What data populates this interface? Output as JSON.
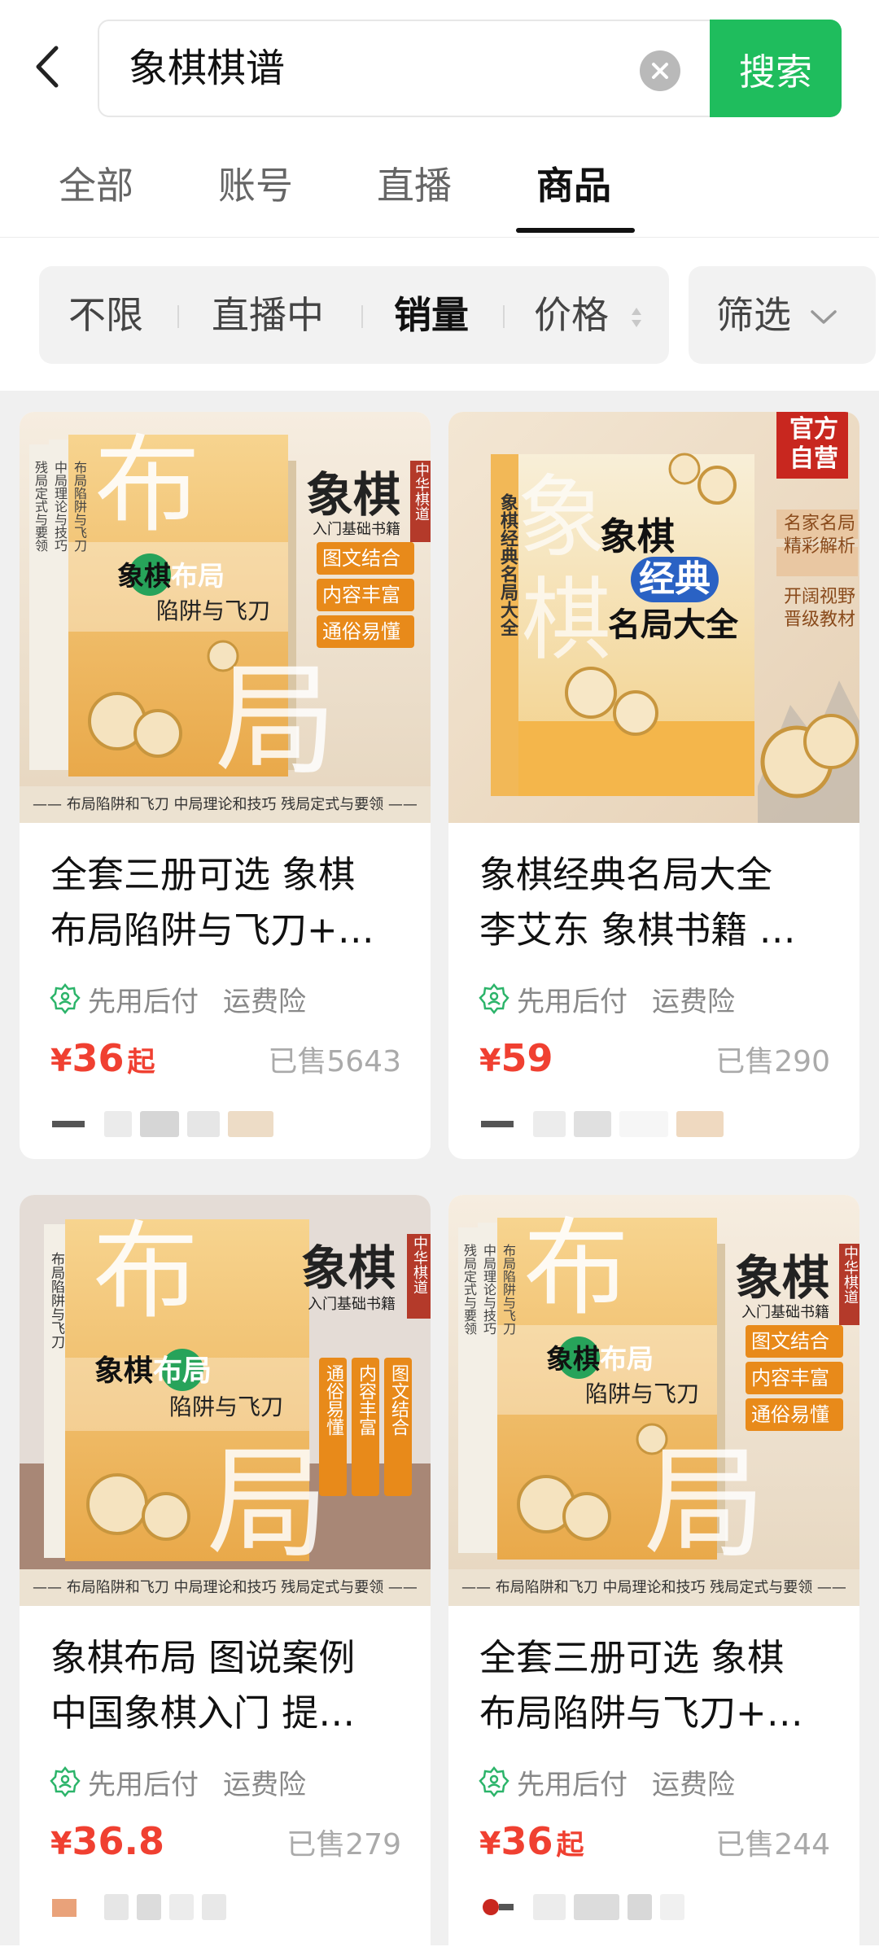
{
  "search": {
    "query": "象棋棋谱",
    "button": "搜索"
  },
  "tabs": [
    {
      "label": "全部"
    },
    {
      "label": "账号"
    },
    {
      "label": "直播"
    },
    {
      "label": "商品"
    }
  ],
  "active_tab": "商品",
  "filters": {
    "items": [
      {
        "label": "不限"
      },
      {
        "label": "直播中"
      },
      {
        "label": "销量"
      },
      {
        "label": "价格"
      }
    ],
    "active": "销量",
    "screen": "筛选"
  },
  "colors": {
    "brand": "#1fbd5d",
    "price": "#f04031"
  },
  "products": [
    {
      "title_line1": "全套三册可选 象棋",
      "title_line2": "布局陷阱与飞刀+…",
      "badge1": "先用后付",
      "badge2": "运费险",
      "price_symbol": "¥",
      "price": "36",
      "price_suffix": "起",
      "sold": "已售5643",
      "cover": {
        "book_title": "象棋布局陷阱与飞刀",
        "book_title_a": "象棋",
        "book_title_b": "布局",
        "book_title_c": "陷阱与飞刀",
        "series": "象棋",
        "series_sub": "入门基础书籍",
        "side_tag": "中华棋道",
        "big_char1": "布",
        "big_char2": "局",
        "spine1": "布局陷阱与飞刀",
        "spine2": "中局理论与技巧",
        "spine3": "残局定式与要领",
        "tags": [
          "图文结合",
          "内容丰富",
          "通俗易懂"
        ],
        "strip": "—— 布局陷阱和飞刀 中局理论和技巧 残局定式与要领 ——"
      }
    },
    {
      "title_line1": "象棋经典名局大全",
      "title_line2": "李艾东 象棋书籍 …",
      "badge1": "先用后付",
      "badge2": "运费险",
      "price_symbol": "¥",
      "price": "59",
      "price_suffix": "",
      "sold": "已售290",
      "cover": {
        "corner": "官方自营",
        "corner_a": "官方",
        "corner_b": "自营",
        "book_title_a": "象棋",
        "book_title_b": "经典",
        "book_title_c": "名局大全",
        "spine": "象棋经典名局大全",
        "tags": [
          "名家名局",
          "精彩解析",
          "开阔视野",
          "晋级教材"
        ],
        "tag_line1": "名家名局",
        "tag_line2": "精彩解析",
        "tag_line3": "开阔视野",
        "tag_line4": "晋级教材",
        "bg_char1": "象",
        "bg_char2": "棋"
      }
    },
    {
      "title_line1": "象棋布局 图说案例",
      "title_line2": "中国象棋入门 提…",
      "badge1": "先用后付",
      "badge2": "运费险",
      "price_symbol": "¥",
      "price": "36.8",
      "price_suffix": "",
      "sold": "已售279",
      "cover": {
        "book_title_a": "象棋",
        "book_title_b": "布局",
        "book_title_c": "陷阱与飞刀",
        "series": "象棋",
        "series_sub": "入门基础书籍",
        "side_tag": "中华棋道",
        "big_char1": "布",
        "big_char2": "局",
        "spine": "布局陷阱与飞刀",
        "vtags": [
          "通俗易懂",
          "内容丰富",
          "图文结合"
        ],
        "strip": "—— 布局陷阱和飞刀 中局理论和技巧 残局定式与要领 ——"
      }
    },
    {
      "title_line1": "全套三册可选 象棋",
      "title_line2": "布局陷阱与飞刀+…",
      "badge1": "先用后付",
      "badge2": "运费险",
      "price_symbol": "¥",
      "price": "36",
      "price_suffix": "起",
      "sold": "已售244",
      "cover": {
        "book_title_a": "象棋",
        "book_title_b": "布局",
        "book_title_c": "陷阱与飞刀",
        "series": "象棋",
        "series_sub": "入门基础书籍",
        "side_tag": "中华棋道",
        "big_char1": "布",
        "big_char2": "局",
        "spine1": "布局陷阱与飞刀",
        "spine2": "中局理论与技巧",
        "spine3": "残局定式与要领",
        "tags": [
          "图文结合",
          "内容丰富",
          "通俗易懂"
        ],
        "strip": "—— 布局陷阱和飞刀 中局理论和技巧 残局定式与要领 ——"
      }
    }
  ]
}
